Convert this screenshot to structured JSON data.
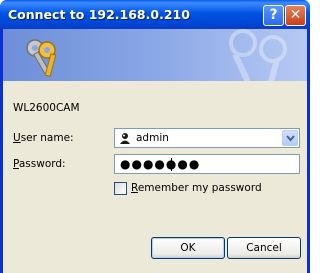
{
  "window": {
    "title": "Connect to 192.168.0.210",
    "help_glyph": "?",
    "close_glyph": "✕"
  },
  "banner": {
    "icon": "keys-icon"
  },
  "form": {
    "server_label": "WL2600CAM",
    "username_label_accel": "U",
    "username_label_rest": "ser name:",
    "username_value": "admin",
    "password_label_accel": "P",
    "password_label_rest": "assword:",
    "password_value": "●●●●●●●",
    "remember_accel": "R",
    "remember_rest": "emember my password",
    "remember_checked": false
  },
  "buttons": {
    "ok": "OK",
    "cancel": "Cancel"
  },
  "colors": {
    "titlebar": "#0054e3",
    "client": "#ece9d8",
    "close": "#c7401a"
  }
}
